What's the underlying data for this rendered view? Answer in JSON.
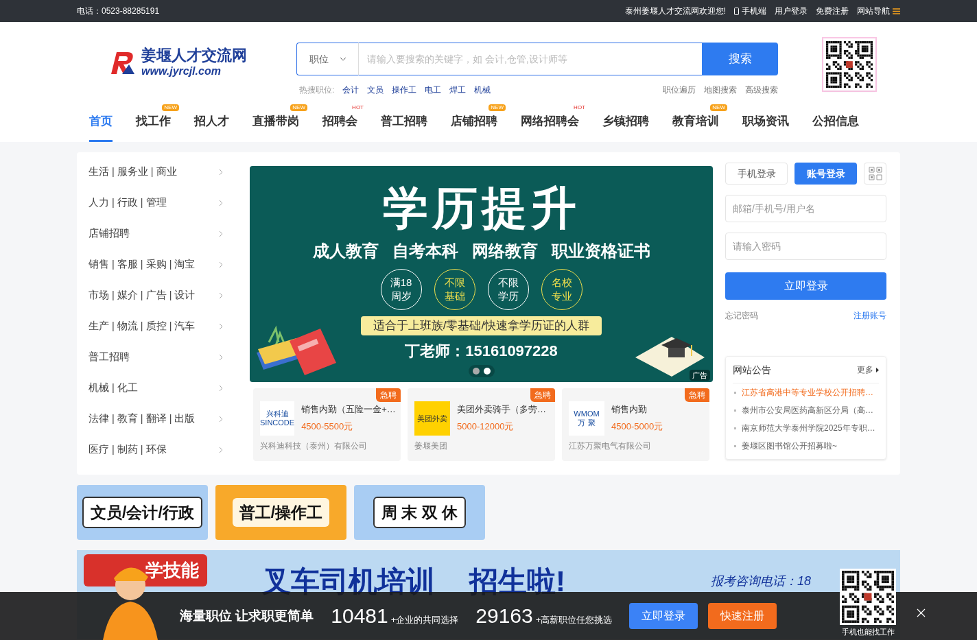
{
  "top_bar": {
    "phone": "电话：0523-88285191",
    "welcome": "泰州姜堰人才交流网欢迎您!",
    "links": [
      "手机端",
      "用户登录",
      "免费注册",
      "网站导航"
    ]
  },
  "logo": {
    "name": "姜堰人才交流网",
    "url": "www.jyrcjl.com"
  },
  "search": {
    "category": "职位",
    "placeholder": "请输入要搜索的关键字，如 会计,仓管,设计师等",
    "button": "搜索",
    "hot_label": "热搜职位:",
    "hot": [
      "会计",
      "文员",
      "操作工",
      "电工",
      "焊工",
      "机械"
    ],
    "links": [
      "职位遍历",
      "地图搜索",
      "高级搜索"
    ]
  },
  "nav": [
    {
      "label": "首页",
      "selected": true
    },
    {
      "label": "找工作",
      "selected": false,
      "tag": "NEW"
    },
    {
      "label": "招人才",
      "selected": false
    },
    {
      "label": "直播带岗",
      "selected": false,
      "tag": "NEW"
    },
    {
      "label": "招聘会",
      "selected": false,
      "tag": "HOT"
    },
    {
      "label": "普工招聘",
      "selected": false
    },
    {
      "label": "店铺招聘",
      "selected": false,
      "tag": "NEW"
    },
    {
      "label": "网络招聘会",
      "selected": false,
      "tag": "HOT"
    },
    {
      "label": "乡镇招聘",
      "selected": false
    },
    {
      "label": "教育培训",
      "selected": false,
      "tag": "NEW"
    },
    {
      "label": "职场资讯",
      "selected": false
    },
    {
      "label": "公招信息",
      "selected": false
    }
  ],
  "categories": [
    "生活 | 服务业 | 商业",
    "人力 | 行政 | 管理",
    "店铺招聘",
    "销售 | 客服 | 采购 | 淘宝",
    "市场 | 媒介 | 广告 | 设计",
    "生产 | 物流 | 质控 | 汽车",
    "普工招聘",
    "机械 | 化工",
    "法律 | 教育 | 翻译 | 出版",
    "医疗 | 制药 | 环保"
  ],
  "banner": {
    "title": "学历提升",
    "subtitles": [
      "成人教育",
      "自考本科",
      "网络教育",
      "职业资格证书"
    ],
    "circles": [
      {
        "lines": [
          "满18",
          "周岁"
        ],
        "color": "#ffffff"
      },
      {
        "lines": [
          "不限",
          "基础"
        ],
        "color": "#f2e14c"
      },
      {
        "lines": [
          "不限",
          "学历"
        ],
        "color": "#ffffff"
      },
      {
        "lines": [
          "名校",
          "专业"
        ],
        "color": "#f2e14c"
      }
    ],
    "slogan": "适合于上班族/零基础/快速拿学历证的人群",
    "contact": "丁老师：15161097228",
    "ad_label": "广告",
    "slides": [
      {
        "selected": false
      },
      {
        "selected": true
      }
    ]
  },
  "jobs": [
    {
      "badge": "急聘",
      "title": "销售内勤（五险一金+…",
      "salary": "4500-5500元",
      "company": "兴科迪科技（泰州）有限公司",
      "logo_text": [
        "兴科迪",
        "SINCODE"
      ]
    },
    {
      "badge": "急聘",
      "title": "美团外卖骑手（多劳…",
      "salary": "5000-12000元",
      "company": "姜堰美团",
      "logo_text": [
        "美团外卖"
      ]
    },
    {
      "badge": "急聘",
      "title": "销售内勤",
      "salary": "4500-5000元",
      "company": "江苏万聚电气有限公司",
      "logo_text": [
        "WMOM",
        "万 聚"
      ]
    }
  ],
  "login": {
    "tabs": [
      {
        "label": "手机登录",
        "selected": false
      },
      {
        "label": "账号登录",
        "selected": true
      }
    ],
    "username_placeholder": "邮箱/手机号/用户名",
    "password_placeholder": "请输入密码",
    "button": "立即登录",
    "forgot": "忘记密码",
    "register": "注册账号"
  },
  "notices": {
    "title": "网站公告",
    "more": "更多",
    "items": [
      {
        "text": "江苏省高港中等专业学校公开招聘…",
        "highlighted": true
      },
      {
        "text": "泰州市公安局医药高新区分局（高…",
        "highlighted": false
      },
      {
        "text": "南京师范大学泰州学院2025年专职…",
        "highlighted": false
      },
      {
        "text": "姜堰区图书馆公开招募啦~",
        "highlighted": false
      }
    ]
  },
  "promo_tiles": [
    {
      "text": "文员/会计/行政",
      "kind": "bubble"
    },
    {
      "text": "普工/操作工",
      "kind": "orange"
    },
    {
      "text": "周 末 双 休",
      "kind": "bubble"
    }
  ],
  "ad_banner": {
    "badge": "学技能",
    "title": "叉车司机培训",
    "title2": "招生啦!",
    "phone": "报考咨询电话：18"
  },
  "footer_bar": {
    "slogan": "海量职位 让求职更简单",
    "stats": [
      {
        "value": "10481",
        "label": "+企业的共同选择"
      },
      {
        "value": "29163",
        "label": "+高薪职位任您挑选"
      }
    ],
    "login": "立即登录",
    "register": "快速注册",
    "qr_caption": "手机也能找工作"
  }
}
